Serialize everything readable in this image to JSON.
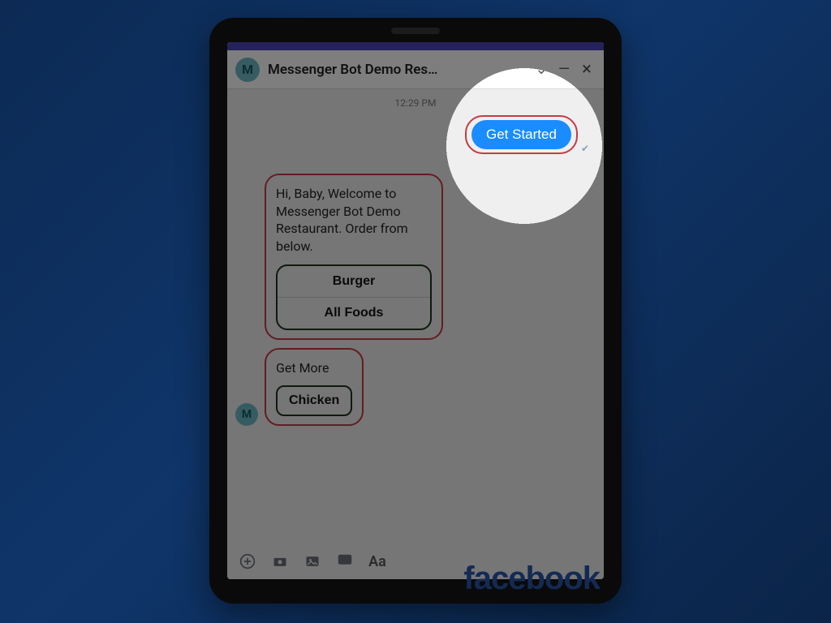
{
  "header": {
    "avatar_initial": "M",
    "title": "Messenger Bot Demo Res…"
  },
  "chat": {
    "timestamp": "12:29 PM",
    "sent_button_label": "Get Started",
    "bot_avatar_initial": "M",
    "card1": {
      "text": "Hi,  Baby, Welcome to Messenger Bot Demo Restaurant. Order from below.",
      "options": [
        "Burger",
        "All Foods"
      ]
    },
    "card2": {
      "text": "Get More",
      "options": [
        "Chicken"
      ]
    }
  },
  "composer": {
    "aa_label": "Aa"
  },
  "brand": {
    "logo_text": "facebook"
  },
  "colors": {
    "accent_blue": "#1a8cff",
    "highlight_red": "#c63a45",
    "option_border": "#1e331e"
  }
}
